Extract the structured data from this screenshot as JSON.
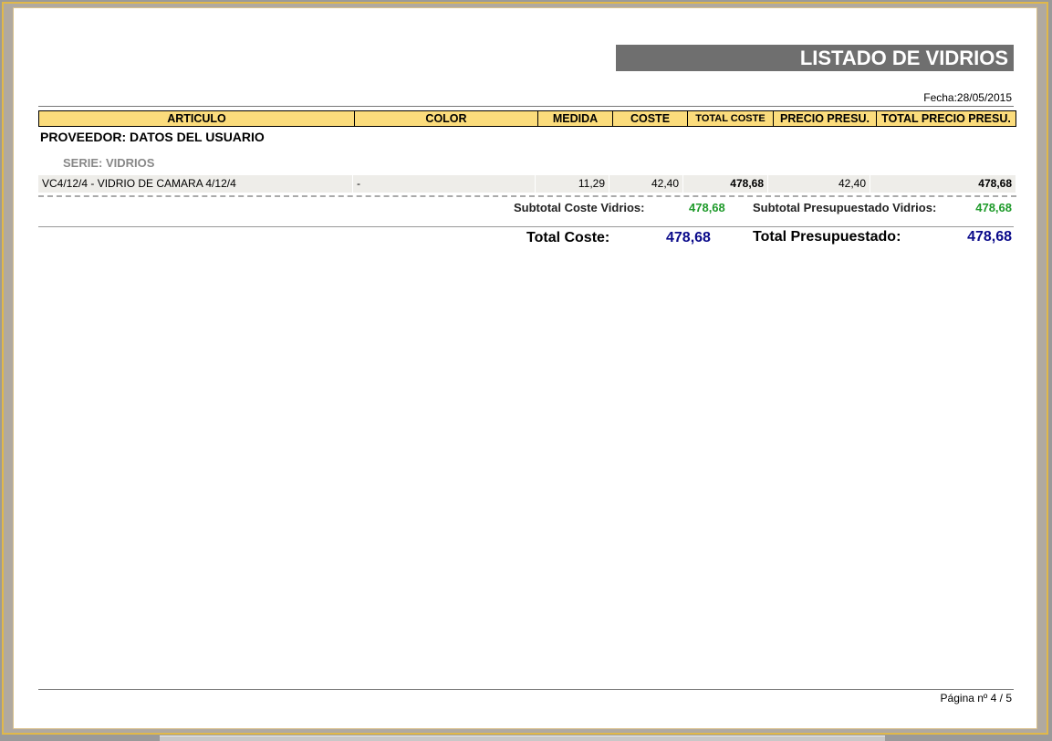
{
  "report": {
    "title": "LISTADO DE VIDRIOS",
    "fecha": "Fecha:28/05/2015",
    "columns": [
      "ARTICULO",
      "COLOR",
      "MEDIDA",
      "COSTE",
      "TOTAL COSTE",
      "PRECIO PRESU.",
      "TOTAL PRECIO PRESU."
    ],
    "proveedor": "PROVEEDOR: DATOS DEL USUARIO",
    "serie": "SERIE: VIDRIOS",
    "rows": [
      {
        "articulo": "VC4/12/4 - VIDRIO DE CAMARA 4/12/4",
        "color": "-",
        "medida": "11,29",
        "coste": "42,40",
        "total_coste": "478,68",
        "precio_presu": "42,40",
        "total_precio_presu": "478,68"
      }
    ],
    "subtotal_coste_label": "Subtotal Coste Vidrios:",
    "subtotal_coste_value": "478,68",
    "subtotal_presu_label": "Subtotal Presupuestado Vidrios:",
    "subtotal_presu_value": "478,68",
    "total_coste_label": "Total Coste:",
    "total_coste_value": "478,68",
    "total_presu_label": "Total Presupuestado:",
    "total_presu_value": "478,68",
    "pagina": "Página nº 4 / 5"
  },
  "colors": {
    "header_bg": "#fbdc7c",
    "subtotal": "#1e9a2a",
    "total": "#0a0a8a",
    "title_bg": "#6f6f6f"
  }
}
